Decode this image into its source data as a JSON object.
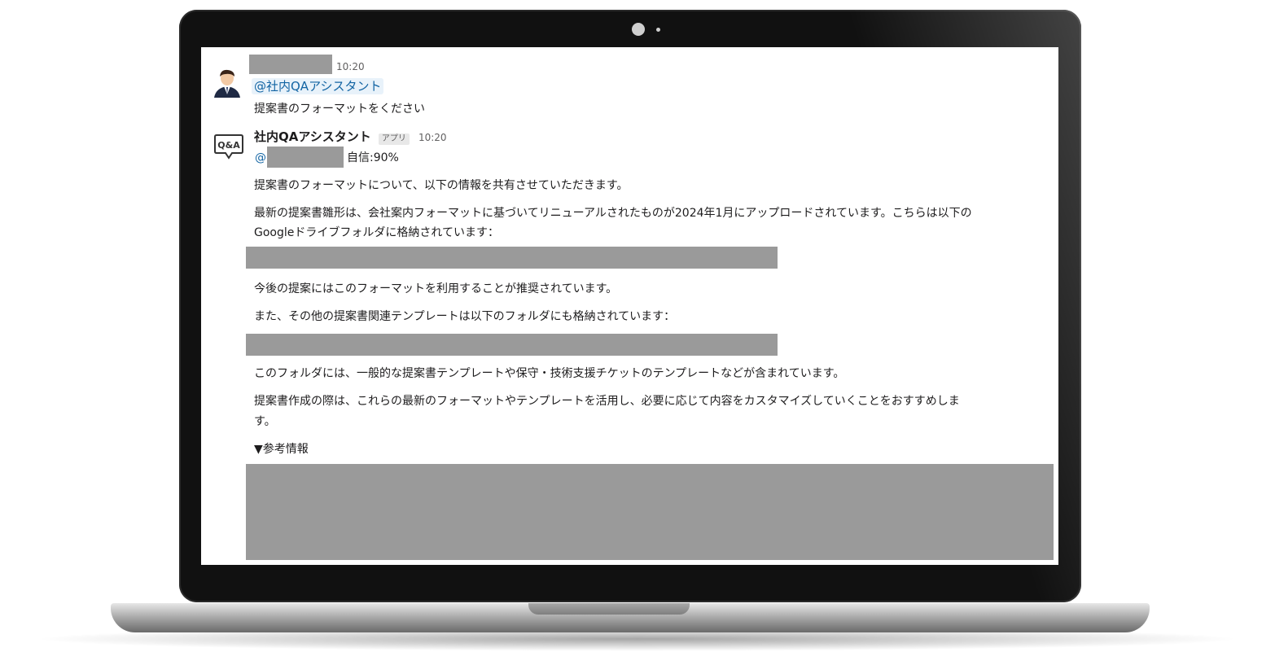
{
  "message1": {
    "time": "10:20",
    "mention": "@社内QAアシスタント",
    "text": "提案書のフォーマットをください"
  },
  "message2": {
    "sender": "社内QAアシスタント",
    "badge": "アプリ",
    "time": "10:20",
    "mention_prefix": "@",
    "confidence": "自信:90%",
    "avatar_label": "Q&A",
    "p1": "提案書のフォーマットについて、以下の情報を共有させていただきます。",
    "p2_line1": "最新の提案書雛形は、会社案内フォーマットに基づいてリニューアルされたものが2024年1月にアップロードされています。こちらは以下の",
    "p2_line2": "Googleドライブフォルダに格納されています：",
    "p3": "今後の提案にはこのフォーマットを利用することが推奨されています。",
    "p4": "また、その他の提案書関連テンプレートは以下のフォルダにも格納されています：",
    "p5": "このフォルダには、一般的な提案書テンプレートや保守・技術支援チケットのテンプレートなどが含まれています。",
    "p6_line1": "提案書作成の際は、これらの最新のフォーマットやテンプレートを活用し、必要に応じて内容をカスタマイズしていくことをおすすめしま",
    "p6_line2": "す。",
    "reference": "▼参考情報"
  },
  "colors": {
    "mention": "#1264a3",
    "redaction": "#9a9a9a",
    "text": "#1d1c1d"
  }
}
